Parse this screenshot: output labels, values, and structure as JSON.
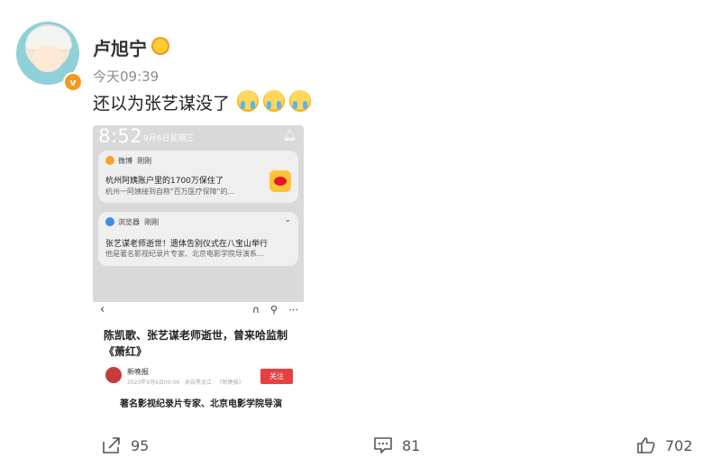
{
  "post": {
    "username": "卢旭宁",
    "timestamp": "今天09:39",
    "text": "还以为张艺谋没了",
    "emoji_count": 3,
    "emoji_icon": "crying-face-icon"
  },
  "screenshot": {
    "clock": "8:52",
    "date": "9月6日星期三",
    "notifications": [
      {
        "app": "微博",
        "time": "刚刚",
        "title": "杭州阿姨账户里的1700万保住了",
        "body": "杭州一阿姨接到自称\"百万医疗保障\"的..."
      },
      {
        "app": "浏览器",
        "time": "刚刚",
        "title": "张艺谋老师逝世！遗体告别仪式在八宝山举行",
        "body": "他是著名影视纪录片专家、北京电影学院导演系..."
      }
    ],
    "article": {
      "title": "陈凯歌、张艺谋老师逝世，曾来哈监制《萧红》",
      "source": "新晚报",
      "meta": "2023年9月6日00:06 · 来自黑龙江 · 《新晚报》",
      "follow": "关注",
      "snippet": "著名影视纪录片专家、北京电影学院导演"
    }
  },
  "actions": {
    "shares": "95",
    "comments": "81",
    "likes": "702"
  },
  "colors": {
    "accent_red": "#e64040",
    "verify_orange": "#f39a1e",
    "meta_gray": "#8c8c8c"
  }
}
